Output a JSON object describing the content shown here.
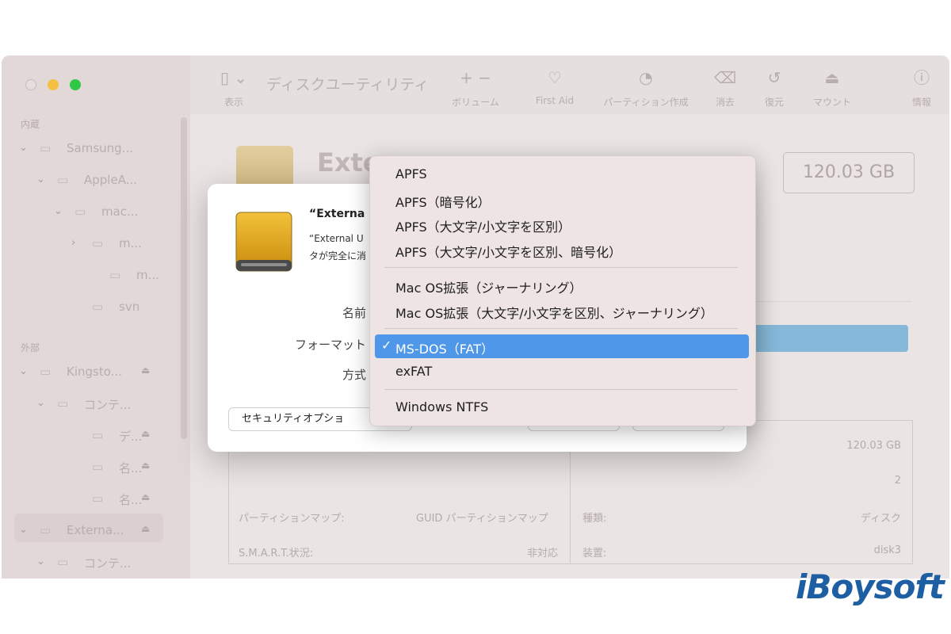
{
  "app_title": "ディスクユーティリティ",
  "toolbar": {
    "view_label": "表示",
    "items": [
      {
        "glyph": "+  −",
        "label": "ボリューム"
      },
      {
        "glyph": "♡",
        "label": "First Aid"
      },
      {
        "glyph": "◔",
        "label": "パーティション作成"
      },
      {
        "glyph": "⌫",
        "label": "消去"
      },
      {
        "glyph": "↺",
        "label": "復元"
      },
      {
        "glyph": "⏏",
        "label": "マウント"
      },
      {
        "glyph": "ⓘ",
        "label": "情報"
      }
    ]
  },
  "sidebar": {
    "internal_header": "内蔵",
    "external_header": "外部",
    "internal_items": [
      {
        "label": "Samsung...",
        "indent": 0,
        "chev": "⌄",
        "eject": false
      },
      {
        "label": "AppleA...",
        "indent": 1,
        "chev": "⌄",
        "eject": false
      },
      {
        "label": "mac...",
        "indent": 2,
        "chev": "⌄",
        "eject": false
      },
      {
        "label": "m...",
        "indent": 3,
        "chev": "›",
        "eject": false
      },
      {
        "label": "m...",
        "indent": 4,
        "chev": "",
        "eject": false
      },
      {
        "label": "svn",
        "indent": 3,
        "chev": "",
        "eject": false
      }
    ],
    "external_items": [
      {
        "label": "Kingsto...",
        "indent": 0,
        "chev": "⌄",
        "eject": true
      },
      {
        "label": "コンテ...",
        "indent": 1,
        "chev": "⌄",
        "eject": false
      },
      {
        "label": "デ...",
        "indent": 3,
        "chev": "",
        "eject": true
      },
      {
        "label": "名...",
        "indent": 3,
        "chev": "",
        "eject": true
      },
      {
        "label": "名...",
        "indent": 3,
        "chev": "",
        "eject": true
      },
      {
        "label": "Externa...",
        "indent": 0,
        "chev": "⌄",
        "eject": true
      },
      {
        "label": "コンテ...",
        "indent": 1,
        "chev": "⌄",
        "eject": false
      }
    ]
  },
  "main": {
    "disk_title": "Exte",
    "capacity": "120.03 GB",
    "info": {
      "capacity_value": "120.03 GB",
      "count_value": "2",
      "partition_map_label": "パーティションマップ:",
      "partition_map_value": "GUID パーティションマップ",
      "type_label": "種類:",
      "type_value": "ディスク",
      "smart_label": "S.M.A.R.T.状況:",
      "smart_value": "非対応",
      "device_label": "装置:",
      "device_value": "disk3"
    }
  },
  "dialog": {
    "title": "“Externa",
    "message_line1": "“External U",
    "message_line2": "タが完全に消",
    "name_label": "名前",
    "format_label": "フォーマット",
    "scheme_label": "方式",
    "security_button": "セキュリティオプショ"
  },
  "format_menu": {
    "groups": [
      [
        "APFS",
        "APFS（暗号化）",
        "APFS（大文字/小文字を区別）",
        "APFS（大文字/小文字を区別、暗号化）"
      ],
      [
        "Mac OS拡張（ジャーナリング）",
        "Mac OS拡張（大文字/小文字を区別、ジャーナリング）"
      ],
      [
        "MS-DOS（FAT）",
        "exFAT"
      ],
      [
        "Windows NTFS"
      ]
    ],
    "selected": "MS-DOS（FAT）",
    "checkmark": "✓"
  },
  "brand": "iBoysoft",
  "colors": {
    "accent_blue": "#4f97e8",
    "brand_blue": "#1e5fa3",
    "usage_bar": "#86b9d9"
  }
}
